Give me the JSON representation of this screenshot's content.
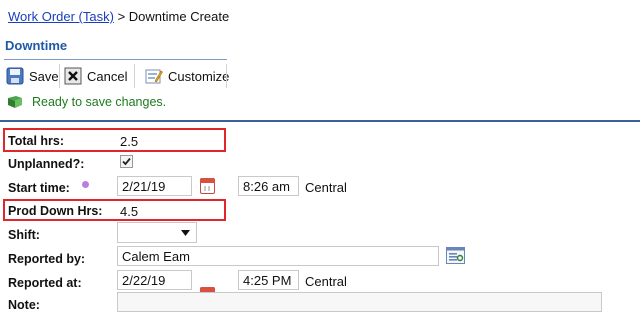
{
  "breadcrumb": {
    "link": "Work Order (Task)",
    "separator": ">",
    "current": "Downtime Create"
  },
  "section": {
    "title": "Downtime"
  },
  "toolbar": {
    "save_label": "Save",
    "cancel_label": "Cancel",
    "customize_label": "Customize"
  },
  "status": {
    "message": "Ready to save changes."
  },
  "form": {
    "total_hrs": {
      "label": "Total hrs:",
      "value": "2.5"
    },
    "unplanned": {
      "label": "Unplanned?:",
      "checked": true
    },
    "start_time": {
      "label": "Start time:",
      "date": "2/21/19",
      "time": "8:26 am",
      "timezone": "Central"
    },
    "prod_down_hrs": {
      "label": "Prod Down Hrs:",
      "value": "4.5"
    },
    "shift": {
      "label": "Shift:",
      "value": ""
    },
    "reported_by": {
      "label": "Reported by:",
      "value": "Calem Eam"
    },
    "reported_at": {
      "label": "Reported at:",
      "date": "2/22/19",
      "time": "4:25 PM",
      "timezone": "Central"
    },
    "note": {
      "label": "Note:",
      "value": ""
    }
  },
  "colors": {
    "accent": "#1f5aa6",
    "link": "#1a3fbf",
    "status_green": "#1e7a1e",
    "highlight_red": "#e0252b"
  },
  "icons": [
    "save-icon",
    "cancel-icon",
    "customize-icon",
    "status-flag-icon",
    "required-dot-icon",
    "calendar-icon",
    "lookup-icon",
    "chevron-down-icon",
    "checkmark-icon"
  ]
}
